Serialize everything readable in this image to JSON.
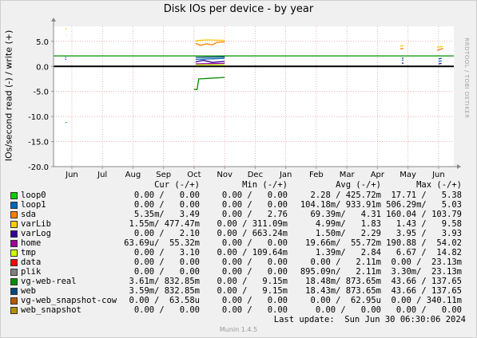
{
  "chart_data": {
    "type": "line",
    "title": "Disk IOs per device - by year",
    "ylabel": "IOs/second read (-) / write (+)",
    "ylim": [
      -20,
      8
    ],
    "y_ticks": [
      {
        "v": 5,
        "label": "5.0"
      },
      {
        "v": 0,
        "label": "0.0"
      },
      {
        "v": -5,
        "label": "-5.0"
      },
      {
        "v": -10,
        "label": "-10.0"
      },
      {
        "v": -15,
        "label": "-15.0"
      },
      {
        "v": -20,
        "label": "-20.0"
      }
    ],
    "x_ticks": [
      {
        "m": 0.6,
        "label": "Jun"
      },
      {
        "m": 1.6,
        "label": "Jul"
      },
      {
        "m": 2.6,
        "label": "Aug"
      },
      {
        "m": 3.6,
        "label": "Sep"
      },
      {
        "m": 4.6,
        "label": "Oct"
      },
      {
        "m": 5.6,
        "label": "Nov"
      },
      {
        "m": 6.6,
        "label": "Dec"
      },
      {
        "m": 7.6,
        "label": "Jan"
      },
      {
        "m": 8.6,
        "label": "Feb"
      },
      {
        "m": 9.6,
        "label": "Mar"
      },
      {
        "m": 10.6,
        "label": "Apr"
      },
      {
        "m": 11.6,
        "label": "May"
      },
      {
        "m": 12.6,
        "label": "Jun"
      }
    ],
    "x_range": [
      0,
      13.1
    ],
    "series": [
      {
        "name": "loop0",
        "color": "#00cc00",
        "segments": [
          [
            [
              4.6,
              0
            ],
            [
              5.6,
              0
            ]
          ]
        ]
      },
      {
        "name": "loop1",
        "color": "#0066b3",
        "segments": [
          [
            [
              0.4,
              1.9
            ],
            [
              0.4,
              1.7
            ]
          ],
          [
            [
              4.65,
              1.4
            ],
            [
              5.6,
              1.6
            ]
          ],
          [
            [
              11.4,
              1.2
            ],
            [
              11.45,
              1.3
            ]
          ],
          [
            [
              12.6,
              1.0
            ],
            [
              12.7,
              1.1
            ]
          ]
        ]
      },
      {
        "name": "sda",
        "color": "#ff8000",
        "segments": [
          [
            [
              0.42,
              6.2
            ],
            [
              0.42,
              6.3
            ]
          ],
          [
            [
              4.65,
              4.6
            ],
            [
              4.8,
              4.2
            ],
            [
              5.0,
              4.5
            ],
            [
              5.2,
              4.3
            ],
            [
              5.35,
              4.8
            ],
            [
              5.6,
              4.9
            ]
          ],
          [
            [
              11.35,
              3.5
            ],
            [
              11.45,
              3.6
            ]
          ],
          [
            [
              12.55,
              3.2
            ],
            [
              12.75,
              3.6
            ]
          ]
        ]
      },
      {
        "name": "varLib",
        "color": "#ffcc00",
        "segments": [
          [
            [
              0.4,
              7.4
            ],
            [
              0.42,
              7.6
            ]
          ],
          [
            [
              4.65,
              5.1
            ],
            [
              5.0,
              5.3
            ],
            [
              5.6,
              5.2
            ]
          ],
          [
            [
              11.35,
              4.0
            ],
            [
              11.45,
              4.2
            ]
          ],
          [
            [
              12.55,
              3.8
            ],
            [
              12.75,
              4.0
            ]
          ]
        ]
      },
      {
        "name": "varLog",
        "color": "#330099",
        "segments": [
          [
            [
              0.4,
              1.5
            ],
            [
              0.4,
              1.3
            ]
          ],
          [
            [
              4.65,
              0.9
            ],
            [
              4.9,
              1.2
            ],
            [
              5.2,
              0.8
            ],
            [
              5.6,
              1.0
            ]
          ],
          [
            [
              11.4,
              0.6
            ],
            [
              11.45,
              0.7
            ]
          ],
          [
            [
              12.6,
              0.5
            ],
            [
              12.7,
              0.6
            ]
          ]
        ]
      },
      {
        "name": "home",
        "color": "#990099",
        "segments": [
          [
            [
              4.65,
              0.5
            ],
            [
              5.6,
              0.6
            ]
          ]
        ]
      },
      {
        "name": "tmp",
        "color": "#ccff00",
        "segments": [
          [
            [
              4.65,
              0.3
            ],
            [
              5.6,
              0.3
            ]
          ]
        ]
      },
      {
        "name": "data",
        "color": "#ff0000",
        "segments": []
      },
      {
        "name": "plik",
        "color": "#808080",
        "segments": []
      },
      {
        "name": "vg-web-real",
        "color": "#008f00",
        "segments": [
          [
            [
              0.4,
              -11.3
            ],
            [
              0.42,
              -11.1
            ]
          ],
          [
            [
              0,
              2.1
            ],
            [
              4.5,
              2.1
            ],
            [
              13.1,
              2.1
            ]
          ],
          [
            [
              4.6,
              -4.6
            ],
            [
              4.7,
              -4.6
            ],
            [
              4.75,
              -2.5
            ],
            [
              5.6,
              -2.2
            ]
          ]
        ]
      },
      {
        "name": "web",
        "color": "#00487d",
        "segments": [
          [
            [
              4.65,
              1.8
            ],
            [
              5.6,
              1.9
            ]
          ],
          [
            [
              11.4,
              1.6
            ],
            [
              11.45,
              1.7
            ]
          ],
          [
            [
              12.6,
              1.5
            ],
            [
              12.7,
              1.6
            ]
          ]
        ]
      },
      {
        "name": "vg-web_snapshot-cow",
        "color": "#b35a00",
        "segments": []
      },
      {
        "name": "web_snapshot",
        "color": "#b38f00",
        "segments": []
      }
    ]
  },
  "window": {
    "title": "Disk IOs per device - by year",
    "watermark": "RRDTOOL / TOBI OETIKER"
  },
  "legend_header": {
    "cur": "Cur (-/+)",
    "min": "Min (-/+)",
    "avg": "Avg (-/+)",
    "max": "Max (-/+)"
  },
  "legend": [
    {
      "name": "loop0",
      "color": "#00cc00",
      "cur": "0.00 /   0.00",
      "min": "0.00 /   0.00",
      "avg": "2.28 / 425.72m",
      "max": "17.71 /   5.38"
    },
    {
      "name": "loop1",
      "color": "#0066b3",
      "cur": "0.00 /   0.00",
      "min": "0.00 /   0.00",
      "avg": "104.18m/ 933.91m",
      "max": "506.29m/   5.03"
    },
    {
      "name": "sda",
      "color": "#ff8000",
      "cur": "5.35m/   3.49",
      "min": "0.00 /   2.76",
      "avg": "69.39m/   4.31",
      "max": "160.04 / 103.79"
    },
    {
      "name": "varLib",
      "color": "#ffcc00",
      "cur": "1.55m/ 477.47m",
      "min": "0.00 / 311.09m",
      "avg": "4.99m/   1.83",
      "max": "1.43 /   9.58"
    },
    {
      "name": "varLog",
      "color": "#330099",
      "cur": "0.00 /   2.10",
      "min": "0.00 / 663.24m",
      "avg": "1.50m/   2.29",
      "max": "3.95 /   3.93"
    },
    {
      "name": "home",
      "color": "#990099",
      "cur": "63.69u/  55.32m",
      "min": "0.00 /   0.00",
      "avg": "19.66m/  55.72m",
      "max": "190.88 /  54.02"
    },
    {
      "name": "tmp",
      "color": "#ccff00",
      "cur": "0.00 /   3.10",
      "min": "0.00 / 109.64m",
      "avg": "1.39m/   2.84",
      "max": "6.67 /  14.82"
    },
    {
      "name": "data",
      "color": "#ff0000",
      "cur": "0.00 /   0.00",
      "min": "0.00 /   0.00",
      "avg": "0.00 /   2.11m",
      "max": "0.00 /  23.13m"
    },
    {
      "name": "plik",
      "color": "#808080",
      "cur": "0.00 /   0.00",
      "min": "0.00 /   0.00",
      "avg": "895.09n/   2.11m",
      "max": "3.30m/  23.13m"
    },
    {
      "name": "vg-web-real",
      "color": "#008f00",
      "cur": "3.61m/ 832.85m",
      "min": "0.00 /   9.15m",
      "avg": "18.48m/ 873.65m",
      "max": "43.66 / 137.65"
    },
    {
      "name": "web",
      "color": "#00487d",
      "cur": "3.59m/ 832.85m",
      "min": "0.00 /   9.15m",
      "avg": "18.43m/ 873.65m",
      "max": "43.66 / 137.65"
    },
    {
      "name": "vg-web_snapshot-cow",
      "color": "#b35a00",
      "cur": "0.00 /  63.58u",
      "min": "0.00 /   0.00",
      "avg": "0.00 /  62.95u",
      "max": "0.00 / 340.11m"
    },
    {
      "name": "web_snapshot",
      "color": "#b38f00",
      "cur": "0.00 /   0.00",
      "min": "0.00 /   0.00",
      "avg": "0.00 /   0.00",
      "max": "0.00 /   0.00"
    }
  ],
  "last_update": "Last update:  Sun Jun 30 06:30:06 2024",
  "footer": "Munin 1.4.5"
}
